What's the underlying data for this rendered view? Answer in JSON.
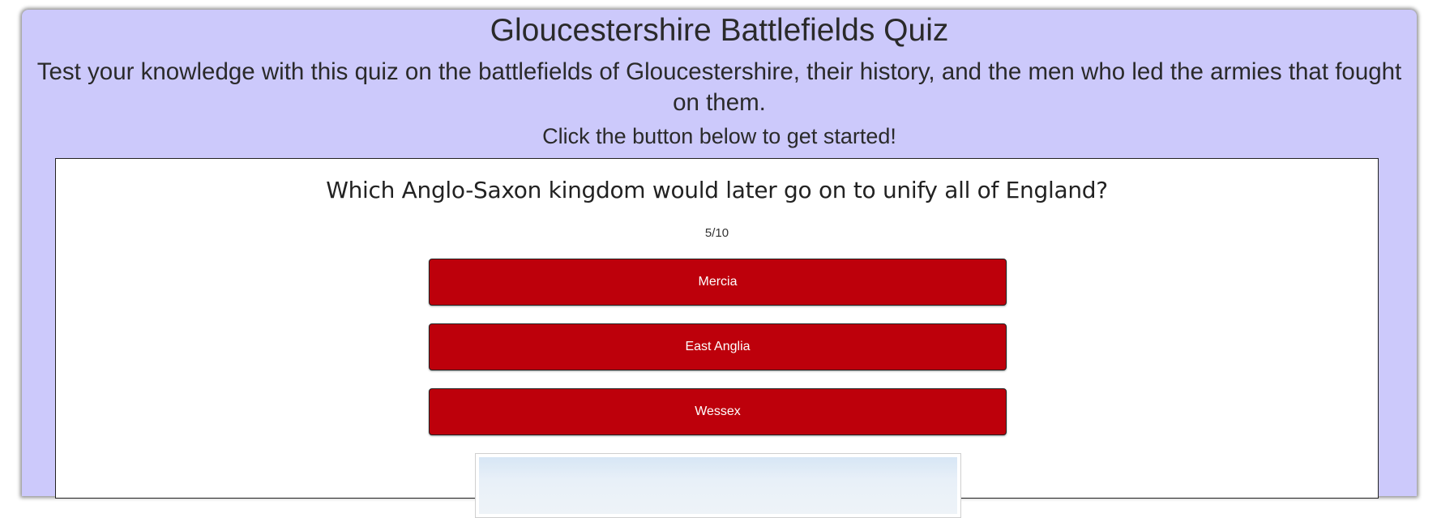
{
  "header": {
    "title": "Gloucestershire Battlefields Quiz",
    "subtitle": "Test your knowledge with this quiz on the battlefields of Gloucestershire, their history, and the men who led the armies that fought on them.",
    "prompt": "Click the button below to get started!"
  },
  "quiz": {
    "question": "Which Anglo-Saxon kingdom would later go on to unify all of England?",
    "progress": "5/10",
    "answers": [
      {
        "label": "Mercia"
      },
      {
        "label": "East Anglia"
      },
      {
        "label": "Wessex"
      }
    ]
  },
  "colors": {
    "background": "#ccc9fb",
    "answer_button": "#bd000b",
    "quiz_panel": "#ffffff"
  }
}
